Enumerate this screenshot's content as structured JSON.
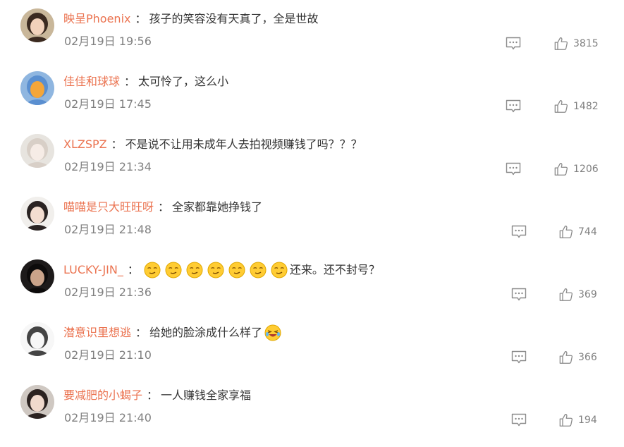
{
  "comments": [
    {
      "username": "映呈Phoenix",
      "separator": "：",
      "text": "孩子的笑容没有天真了，全是世故",
      "text_after": "",
      "emoji_count": 0,
      "trailing_emoji": false,
      "time": "02月19日 19:56",
      "likes": "3815",
      "avatar": {
        "bg": "#c9b79a",
        "face": "#f2d2bb",
        "hair": "#3b2a20"
      }
    },
    {
      "username": "佳佳和球球",
      "separator": "：",
      "text": "太可怜了，这么小",
      "text_after": "",
      "emoji_count": 0,
      "trailing_emoji": false,
      "time": "02月19日 17:45",
      "likes": "1482",
      "avatar": {
        "bg": "#8fb6e0",
        "face": "#f4a63a",
        "hair": "#5a8fd0"
      }
    },
    {
      "username": "XLZSPZ",
      "separator": "：",
      "text": "不是说不让用未成年人去拍视频赚钱了吗？？？",
      "text_after": "",
      "emoji_count": 0,
      "trailing_emoji": false,
      "time": "02月19日 21:34",
      "likes": "1206",
      "avatar": {
        "bg": "#e7e4df",
        "face": "#f6ece6",
        "hair": "#d8cfc7"
      }
    },
    {
      "username": "喵喵是只大旺旺呀",
      "separator": "：",
      "text": "全家都靠她挣钱了",
      "text_after": "",
      "emoji_count": 0,
      "trailing_emoji": false,
      "time": "02月19日 21:48",
      "likes": "744",
      "avatar": {
        "bg": "#f1efec",
        "face": "#f3ddd0",
        "hair": "#2a2322"
      }
    },
    {
      "username": "LUCKY-JIN_",
      "separator": "：",
      "text": "",
      "text_after": "还来。还不封号？",
      "emoji_count": 7,
      "trailing_emoji": false,
      "time": "02月19日 21:36",
      "likes": "369",
      "avatar": {
        "bg": "#1d1a1a",
        "face": "#caa38a",
        "hair": "#0d0b0b"
      }
    },
    {
      "username": "潜意识里想逃",
      "separator": "：",
      "text": "给她的脸涂成什么样了",
      "text_after": "",
      "emoji_count": 0,
      "trailing_emoji": true,
      "time": "02月19日 21:10",
      "likes": "366",
      "avatar": {
        "bg": "#f7f7f7",
        "face": "#f7f7f7",
        "hair": "#444444"
      }
    },
    {
      "username": "要减肥的小蝎子",
      "separator": "：",
      "text": "一人赚钱全家享福",
      "text_after": "",
      "emoji_count": 0,
      "trailing_emoji": false,
      "time": "02月19日 21:40",
      "likes": "194",
      "avatar": {
        "bg": "#cfc8c2",
        "face": "#f0d9cc",
        "hair": "#2b2220"
      }
    }
  ],
  "colors": {
    "username": "#eb7350",
    "text": "#333333",
    "meta": "#808080",
    "icon": "#8a8a8a"
  },
  "icons": {
    "reply": "comment-bubble-icon",
    "like": "thumbs-up-icon",
    "laugh": "laughing-emoji",
    "smirk": "smirk-emoji"
  }
}
